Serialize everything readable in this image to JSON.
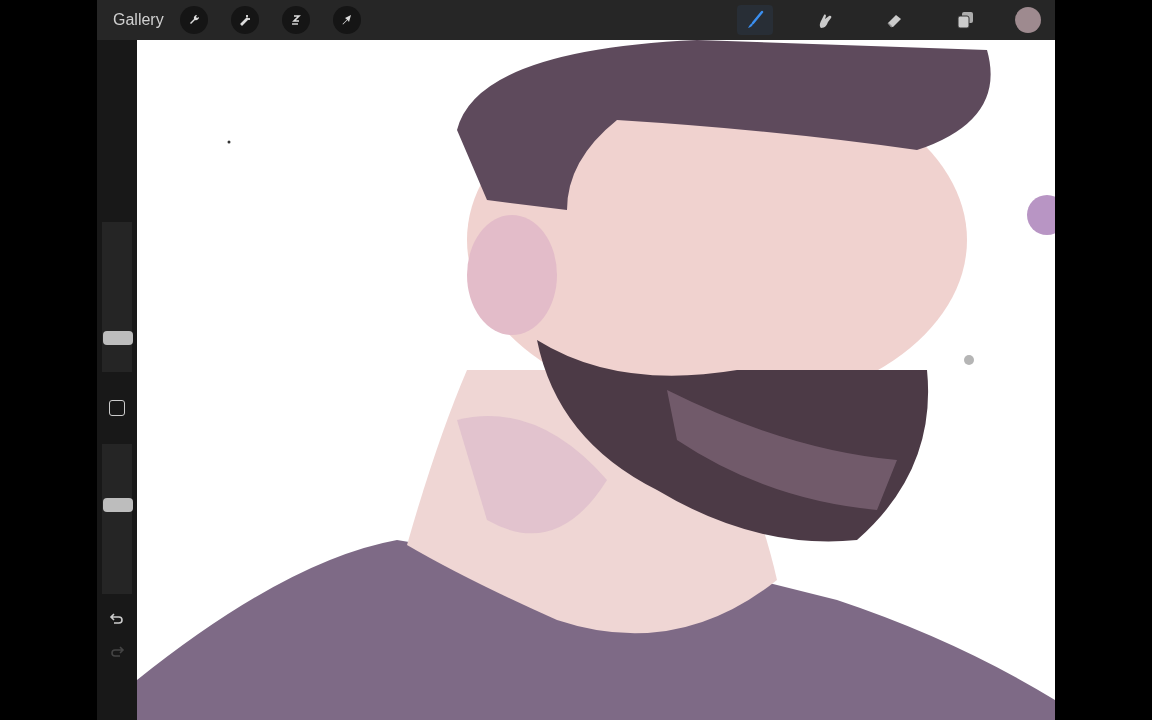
{
  "toolbar": {
    "gallery": "Gallery",
    "actions": [
      {
        "kind": "wrench"
      },
      {
        "kind": "wand"
      },
      {
        "kind": "selection"
      },
      {
        "kind": "transform"
      }
    ],
    "tools": [
      {
        "kind": "brush",
        "selected": true
      },
      {
        "kind": "smudge",
        "selected": false
      },
      {
        "kind": "eraser",
        "selected": false
      },
      {
        "kind": "layers",
        "selected": false
      }
    ],
    "color": "#9e8a8f"
  },
  "sidebar": {
    "size": {
      "level": 0.2
    },
    "opacity": {
      "level": 0.6
    },
    "undo": {
      "disabled": false
    },
    "redo": {
      "disabled": true
    }
  }
}
